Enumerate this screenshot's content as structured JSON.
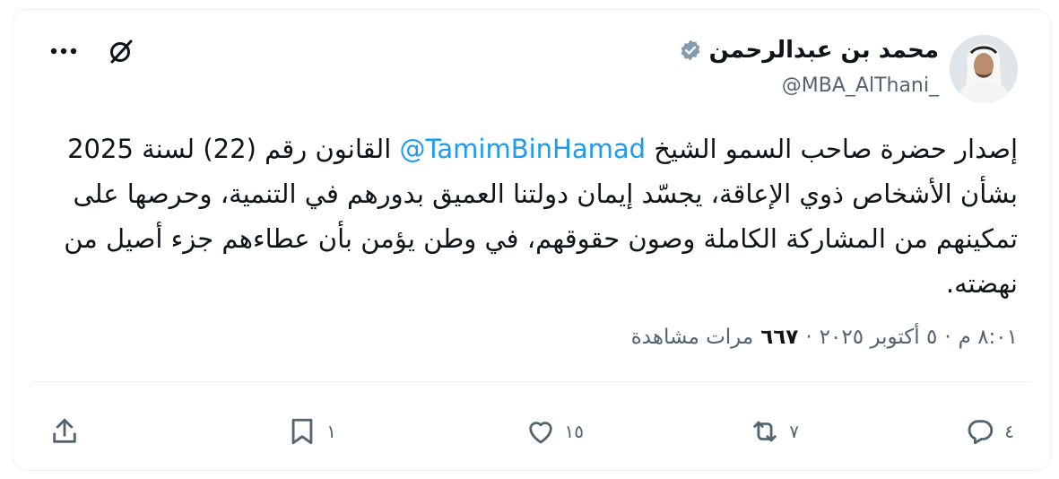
{
  "author": {
    "name": "محمد بن عبدالرحمن",
    "handle": "@MBA_AlThani_"
  },
  "tweet": {
    "before_mention": "إصدار حضرة صاحب السمو الشيخ ",
    "mention": "@TamimBinHamad",
    "after_mention": " القانون رقم (22) لسنة 2025 بشأن الأشخاص ذوي الإعاقة، يجسّد إيمان دولتنا العميق بدورهم في التنمية، وحرصها على تمكينهم من المشاركة الكاملة وصون حقوقهم، في وطن يؤمن بأن عطاءهم جزء أصيل من نهضته."
  },
  "meta": {
    "time": "٨:٠١ م",
    "date": "٥ أكتوبر ٢٠٢٥",
    "separator": "·",
    "views_count": "٦٦٧",
    "views_label": "مرات مشاهدة"
  },
  "actions": {
    "replies": "٤",
    "reposts": "٧",
    "likes": "١٥",
    "bookmarks": "١"
  },
  "colors": {
    "accent": "#1d9bf0",
    "verified": "#829aab",
    "muted": "#536471"
  },
  "icons": [
    "verified-icon",
    "grok-icon",
    "more-icon",
    "reply-icon",
    "repost-icon",
    "like-icon",
    "bookmark-icon",
    "share-icon"
  ]
}
